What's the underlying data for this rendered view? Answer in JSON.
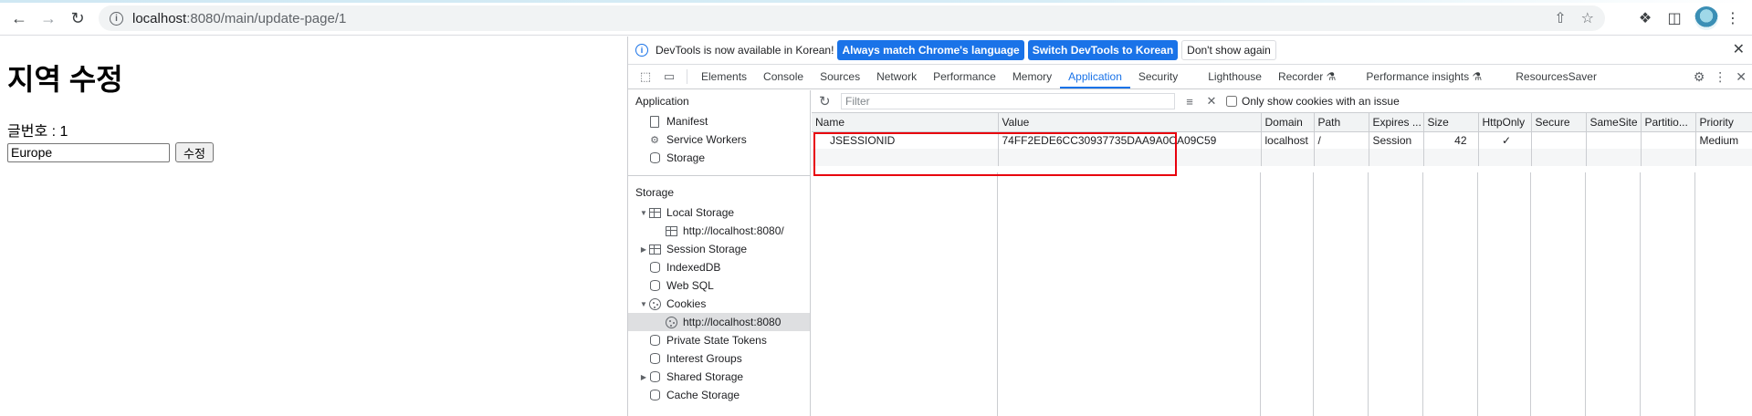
{
  "browser": {
    "url_host": "localhost",
    "url_path": ":8080/main/update-page/1"
  },
  "page": {
    "title": "지역 수정",
    "post_label": "글번호 : 1",
    "region_value": "Europe",
    "submit_label": "수정"
  },
  "devtools": {
    "infobar": {
      "message": "DevTools is now available in Korean!",
      "btn_match": "Always match Chrome's language",
      "btn_switch": "Switch DevTools to Korean",
      "btn_dismiss": "Don't show again"
    },
    "tabs": [
      "Elements",
      "Console",
      "Sources",
      "Network",
      "Performance",
      "Memory",
      "Application",
      "Security",
      "Lighthouse",
      "Recorder",
      "Performance insights",
      "ResourcesSaver"
    ],
    "active_tab": "Application",
    "sidebar": {
      "application_head": "Application",
      "application_items": [
        "Manifest",
        "Service Workers",
        "Storage"
      ],
      "storage_head": "Storage",
      "local_storage": "Local Storage",
      "local_storage_origin": "http://localhost:8080/",
      "session_storage": "Session Storage",
      "indexeddb": "IndexedDB",
      "websql": "Web SQL",
      "cookies": "Cookies",
      "cookies_origin": "http://localhost:8080",
      "private_state_tokens": "Private State Tokens",
      "interest_groups": "Interest Groups",
      "shared_storage": "Shared Storage",
      "cache_storage": "Cache Storage"
    },
    "filter": {
      "placeholder": "Filter",
      "only_issue_label": "Only show cookies with an issue"
    },
    "table": {
      "columns": [
        "Name",
        "Value",
        "Domain",
        "Path",
        "Expires ...",
        "Size",
        "HttpOnly",
        "Secure",
        "SameSite",
        "Partitio...",
        "Priority"
      ],
      "rows": [
        {
          "name": "JSESSIONID",
          "value": "74FF2EDE6CC30937735DAA9A0CA09C59",
          "domain": "localhost",
          "path": "/",
          "expires": "Session",
          "size": "42",
          "httponly": "✓",
          "secure": "",
          "samesite": "",
          "partition": "",
          "priority": "Medium"
        }
      ]
    }
  },
  "colors": {
    "accent": "#1a73e8",
    "highlight": "#e8000d"
  }
}
